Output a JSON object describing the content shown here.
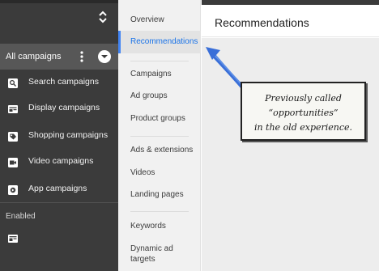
{
  "sidebar": {
    "all_campaigns_label": "All campaigns",
    "campaign_items": [
      {
        "label": "Search campaigns",
        "icon": "search-icon"
      },
      {
        "label": "Display campaigns",
        "icon": "display-icon"
      },
      {
        "label": "Shopping campaigns",
        "icon": "shopping-tag-icon"
      },
      {
        "label": "Video campaigns",
        "icon": "video-icon"
      },
      {
        "label": "App campaigns",
        "icon": "app-icon"
      }
    ],
    "enabled_label": "Enabled"
  },
  "nav": {
    "items": [
      {
        "label": "Overview"
      },
      {
        "label": "Recommendations",
        "active": true
      },
      {
        "label": "Campaigns"
      },
      {
        "label": "Ad groups"
      },
      {
        "label": "Product groups"
      },
      {
        "label": "Ads & extensions"
      },
      {
        "label": "Videos"
      },
      {
        "label": "Landing pages"
      },
      {
        "label": "Keywords"
      },
      {
        "label": "Dynamic ad"
      },
      {
        "label": "targets"
      }
    ]
  },
  "main": {
    "title": "Recommendations"
  },
  "annotation": {
    "lines": [
      "Previously called",
      "“opportunities”",
      "in the old experience."
    ]
  },
  "colors": {
    "accent": "#1a73e8",
    "sidebar_bg": "#3b3b3b",
    "annotation_arrow": "#3a6fd8"
  }
}
